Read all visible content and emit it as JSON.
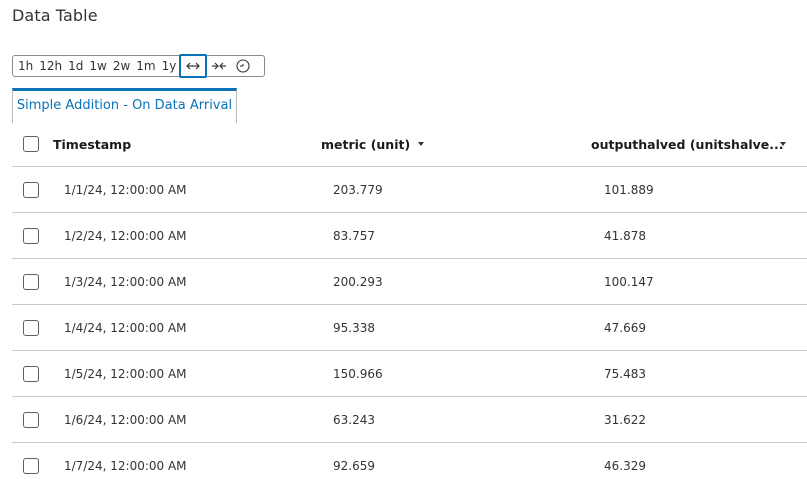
{
  "page": {
    "title": "Data Table"
  },
  "toolbar": {
    "ranges": [
      "1h",
      "12h",
      "1d",
      "1w",
      "2w",
      "1m",
      "1y"
    ],
    "icons": [
      "expand-horizontal-icon",
      "collapse-horizontal-icon",
      "clock-icon"
    ],
    "active_icon": "expand-horizontal-icon"
  },
  "tabs": [
    {
      "label": "Simple Addition - On Data Arrival",
      "active": true
    }
  ],
  "table": {
    "columns": {
      "timestamp": "Timestamp",
      "metric": "metric (unit)",
      "output": "outputhalved (unitshalve..."
    },
    "rows": [
      {
        "timestamp": "1/1/24, 12:00:00 AM",
        "metric": "203.779",
        "output": "101.889"
      },
      {
        "timestamp": "1/2/24, 12:00:00 AM",
        "metric": "83.757",
        "output": "41.878"
      },
      {
        "timestamp": "1/3/24, 12:00:00 AM",
        "metric": "200.293",
        "output": "100.147"
      },
      {
        "timestamp": "1/4/24, 12:00:00 AM",
        "metric": "95.338",
        "output": "47.669"
      },
      {
        "timestamp": "1/5/24, 12:00:00 AM",
        "metric": "150.966",
        "output": "75.483"
      },
      {
        "timestamp": "1/6/24, 12:00:00 AM",
        "metric": "63.243",
        "output": "31.622"
      },
      {
        "timestamp": "1/7/24, 12:00:00 AM",
        "metric": "92.659",
        "output": "46.329"
      }
    ]
  },
  "colors": {
    "accent": "#0a72b8",
    "divider": "#c8c8c8"
  }
}
